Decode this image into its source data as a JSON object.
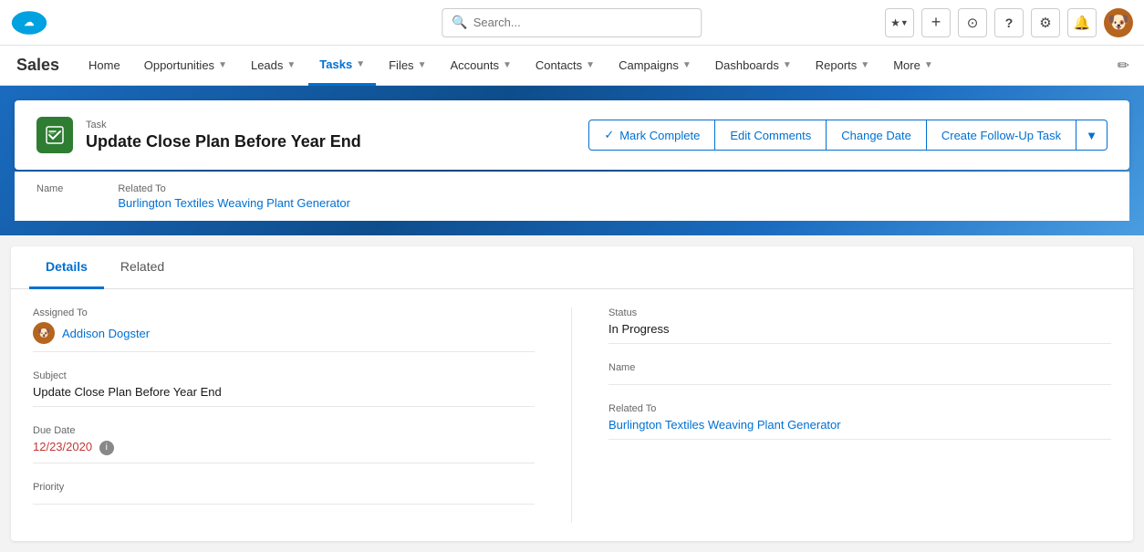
{
  "topbar": {
    "search_placeholder": "Search...",
    "icons": {
      "star": "☆",
      "plus": "+",
      "settings": "⚙",
      "help": "?",
      "gear": "⚙",
      "bell": "🔔",
      "dropdown": "▼"
    }
  },
  "navbar": {
    "brand": "Sales",
    "items": [
      {
        "label": "Home",
        "has_dropdown": false,
        "active": false
      },
      {
        "label": "Opportunities",
        "has_dropdown": true,
        "active": false
      },
      {
        "label": "Leads",
        "has_dropdown": true,
        "active": false
      },
      {
        "label": "Tasks",
        "has_dropdown": true,
        "active": true
      },
      {
        "label": "Files",
        "has_dropdown": true,
        "active": false
      },
      {
        "label": "Accounts",
        "has_dropdown": true,
        "active": false
      },
      {
        "label": "Contacts",
        "has_dropdown": true,
        "active": false
      },
      {
        "label": "Campaigns",
        "has_dropdown": true,
        "active": false
      },
      {
        "label": "Dashboards",
        "has_dropdown": true,
        "active": false
      },
      {
        "label": "Reports",
        "has_dropdown": true,
        "active": false
      },
      {
        "label": "More",
        "has_dropdown": true,
        "active": false
      }
    ]
  },
  "task_header": {
    "object_label": "Task",
    "title": "Update Close Plan Before Year End",
    "icon_char": "✔",
    "actions": {
      "mark_complete": "Mark Complete",
      "edit_comments": "Edit Comments",
      "change_date": "Change Date",
      "create_followup": "Create Follow-Up Task"
    }
  },
  "name_related": {
    "name_label": "Name",
    "related_label": "Related To",
    "related_value": "Burlington Textiles Weaving Plant Generator"
  },
  "details": {
    "tab_details": "Details",
    "tab_related": "Related",
    "assigned_to_label": "Assigned To",
    "assigned_to_value": "Addison Dogster",
    "subject_label": "Subject",
    "subject_value": "Update Close Plan Before Year End",
    "due_date_label": "Due Date",
    "due_date_value": "12/23/2020",
    "priority_label": "Priority",
    "status_label": "Status",
    "status_value": "In Progress",
    "name_label": "Name",
    "name_value": "",
    "related_to_label": "Related To",
    "related_to_value": "Burlington Textiles Weaving Plant Generator"
  }
}
